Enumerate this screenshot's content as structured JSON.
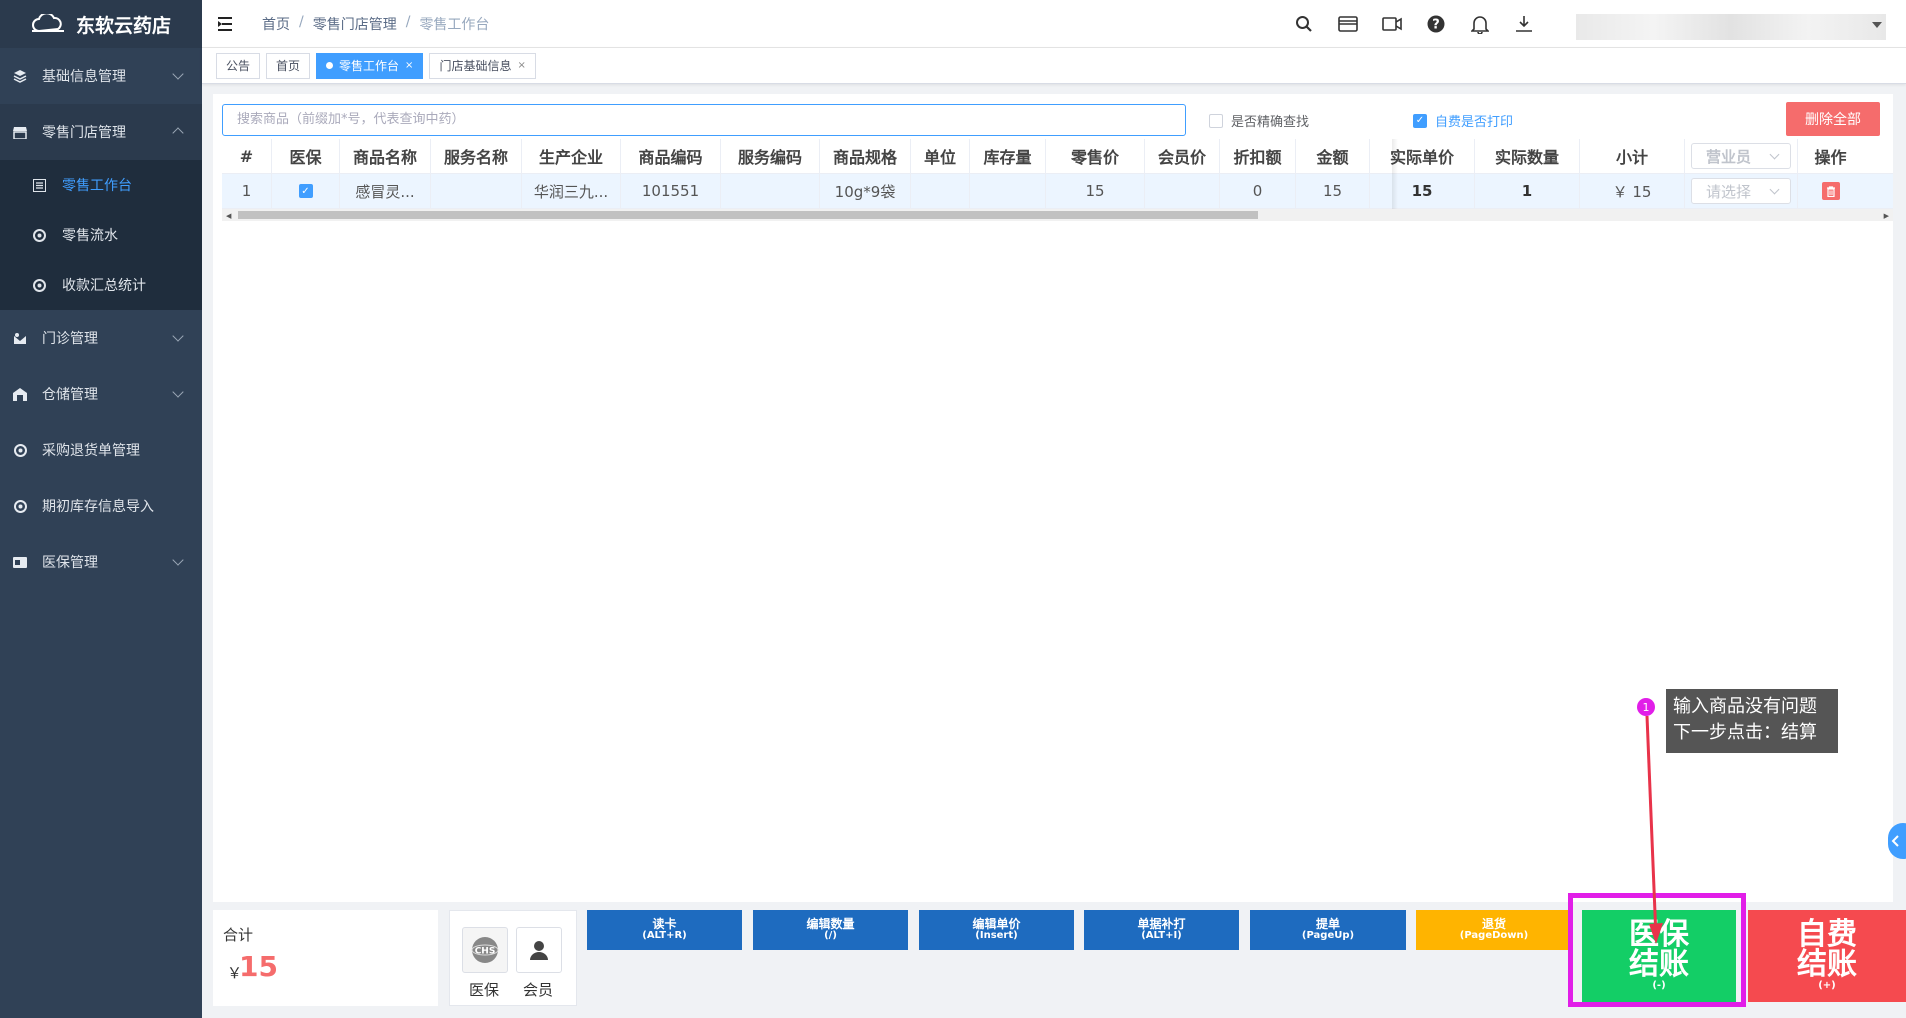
{
  "app": {
    "title": "东软云药店"
  },
  "sidebar": {
    "items": [
      {
        "label": "基础信息管理",
        "icon": "layers-icon"
      },
      {
        "label": "零售门店管理",
        "icon": "store-icon"
      },
      {
        "label": "门诊管理",
        "icon": "clinic-icon"
      },
      {
        "label": "仓储管理",
        "icon": "warehouse-icon"
      },
      {
        "label": "采购退货单管理",
        "icon": "return-icon"
      },
      {
        "label": "期初库存信息导入",
        "icon": "import-icon"
      },
      {
        "label": "医保管理",
        "icon": "insurance-card-icon"
      }
    ],
    "sub_items": [
      {
        "label": "零售工作台",
        "active": true
      },
      {
        "label": "零售流水"
      },
      {
        "label": "收款汇总统计"
      }
    ]
  },
  "breadcrumb": [
    "首页",
    "零售门店管理",
    "零售工作台"
  ],
  "tags": [
    {
      "label": "公告"
    },
    {
      "label": "首页"
    },
    {
      "label": "零售工作台",
      "active": true,
      "close": "×"
    },
    {
      "label": "门店基础信息",
      "close": "×"
    }
  ],
  "toolbar": {
    "search_placeholder": "搜索商品（前缀加*号，代表查询中药）",
    "exact_search_label": "是否精确查找",
    "exact_search_checked": false,
    "self_pay_print_label": "自费是否打印",
    "self_pay_print_checked": true,
    "delete_all_label": "删除全部"
  },
  "table": {
    "headers": [
      "#",
      "医保",
      "商品名称",
      "服务名称",
      "生产企业",
      "商品编码",
      "服务编码",
      "商品规格",
      "单位",
      "库存量",
      "零售价",
      "会员价",
      "折扣额",
      "金额",
      "实际单价",
      "实际数量",
      "小计",
      "营业员",
      "操作"
    ],
    "rows": [
      {
        "index": "1",
        "insured": true,
        "name": "感冒灵...",
        "service": "",
        "manufacturer": "华润三九...",
        "code": "101551",
        "service_code": "",
        "spec": "10g*9袋",
        "unit": "",
        "stock": "",
        "retail_price": "15",
        "member_price": "",
        "discount": "0",
        "amount": "15",
        "actual_price": "15",
        "actual_qty": "1",
        "subtotal": "￥ 15",
        "clerk_placeholder": "请选择"
      }
    ]
  },
  "summary": {
    "total_label": "合计",
    "currency": "￥",
    "total_value": "15"
  },
  "cards": {
    "insurance_label": "医保",
    "member_label": "会员"
  },
  "function_buttons": [
    {
      "label": "读卡",
      "key": "(ALT+R)"
    },
    {
      "label": "编辑数量",
      "key": "(/)"
    },
    {
      "label": "编辑单价",
      "key": "(Insert)"
    },
    {
      "label": "单据补打",
      "key": "(ALT+I)"
    },
    {
      "label": "提单",
      "key": "(PageUp)"
    },
    {
      "label": "退货",
      "key": "(PageDown)"
    }
  ],
  "checkout": {
    "insurance": {
      "line1": "医保",
      "line2": "结账",
      "key": "(-)"
    },
    "self_pay": {
      "line1": "自费",
      "line2": "结账",
      "key": "(+)"
    }
  },
  "tooltip": {
    "step": "1",
    "line1": "输入商品没有问题",
    "line2": "下一步点击：结算"
  },
  "colors": {
    "sidebar": "#304156",
    "accent": "#409eff",
    "danger": "#f56c6c",
    "success": "#13ce66",
    "function_blue": "#1e6bbf",
    "warning": "#ffb400",
    "highlight": "#e11ee8"
  }
}
